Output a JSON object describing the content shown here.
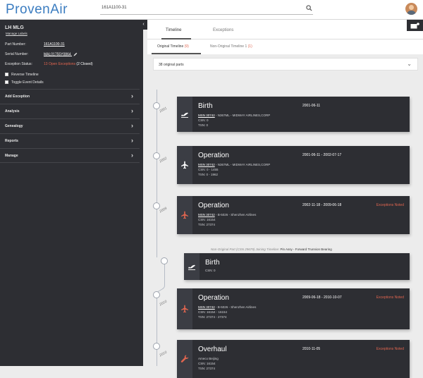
{
  "header": {
    "logo": "ProvenAir",
    "search_value": "161A1100-31"
  },
  "sidebar": {
    "title": "LH MLG",
    "link": "Manage Labels",
    "fields": [
      {
        "label": "Part Number:",
        "value": "161A1100-31"
      },
      {
        "label": "Serial Number:",
        "value": "MAL01755Y0864"
      }
    ],
    "exception_label": "Exception Status:",
    "exception_open": "13 Open Exceptions",
    "exception_closed": "(2 Closed)",
    "checkboxes": [
      "Reverse Timeline",
      "Toggle Event Details"
    ],
    "menu": [
      "Add Exception",
      "Analysis",
      "Genealogy",
      "Reports",
      "Manage"
    ]
  },
  "tabs": [
    "Timeline",
    "Exceptions"
  ],
  "subtabs": [
    {
      "label": "Original Timeline",
      "count": "(9)"
    },
    {
      "label": "Non-Original Timeline 1",
      "count": "(1)"
    }
  ],
  "filter": {
    "text": "38 original parts"
  },
  "timeline": {
    "years": [
      "2001",
      "2002",
      "2009",
      "2010",
      "2010"
    ],
    "note_prefix": "Non-Original Part (CSN 29679) Joining Timeline:",
    "note_part": "Pin Assy - Forward Trunnion Bearing",
    "events": [
      {
        "title": "Birth",
        "icon": "plane-takeoff-icon",
        "date": "2001-06-11",
        "exc": "",
        "msn": "MSN 30742",
        "line1": "- N367ML - MIDWAY AIRLINES,CORP",
        "csn": "CSN: 0",
        "tsn": "TSN: 0"
      },
      {
        "title": "Operation",
        "icon": "plane-icon",
        "date": "2001-06-11 - 2002-07-17",
        "exc": "",
        "msn": "MSN 30742",
        "line1": "- N367ML - MIDWAY AIRLINES,CORP",
        "csn": "CSN: 0 - 1455",
        "tsn": "TSN: 0 - 1962"
      },
      {
        "title": "Operation",
        "icon": "plane-icon",
        "date": "2002-11-18 - 2009-06-18",
        "exc": "Exceptions Noted",
        "msn": "MSN 30742",
        "line1": "- B-5026 - Shenzhen Airlines",
        "csn": "CSN: 16154",
        "tsn": "TSN: 27374"
      },
      {
        "title": "Birth",
        "icon": "plane-takeoff-icon",
        "date": "",
        "exc": "",
        "msn": "",
        "line1": "",
        "csn": "CSN: 0",
        "tsn": ""
      },
      {
        "title": "Operation",
        "icon": "plane-icon",
        "date": "2009-06-18 - 2010-10-07",
        "exc": "Exceptions Noted",
        "msn": "MSN 30742",
        "line1": "- B-5026 - Shenzhen Airlines",
        "csn": "CSN: 16154 - 16154",
        "tsn": "TSN: 27374 - 27374"
      },
      {
        "title": "Overhaul",
        "icon": "wrench-icon",
        "date": "2010-11-05",
        "exc": "Exceptions Noted",
        "msn": "",
        "line1": "Ameco Beijing",
        "csn": "CSN: 16154",
        "tsn": "TSN: 27374"
      }
    ]
  },
  "colors": {
    "accent": "#3a7cc0",
    "exception": "#e0654f",
    "dark": "#2d2e33"
  }
}
